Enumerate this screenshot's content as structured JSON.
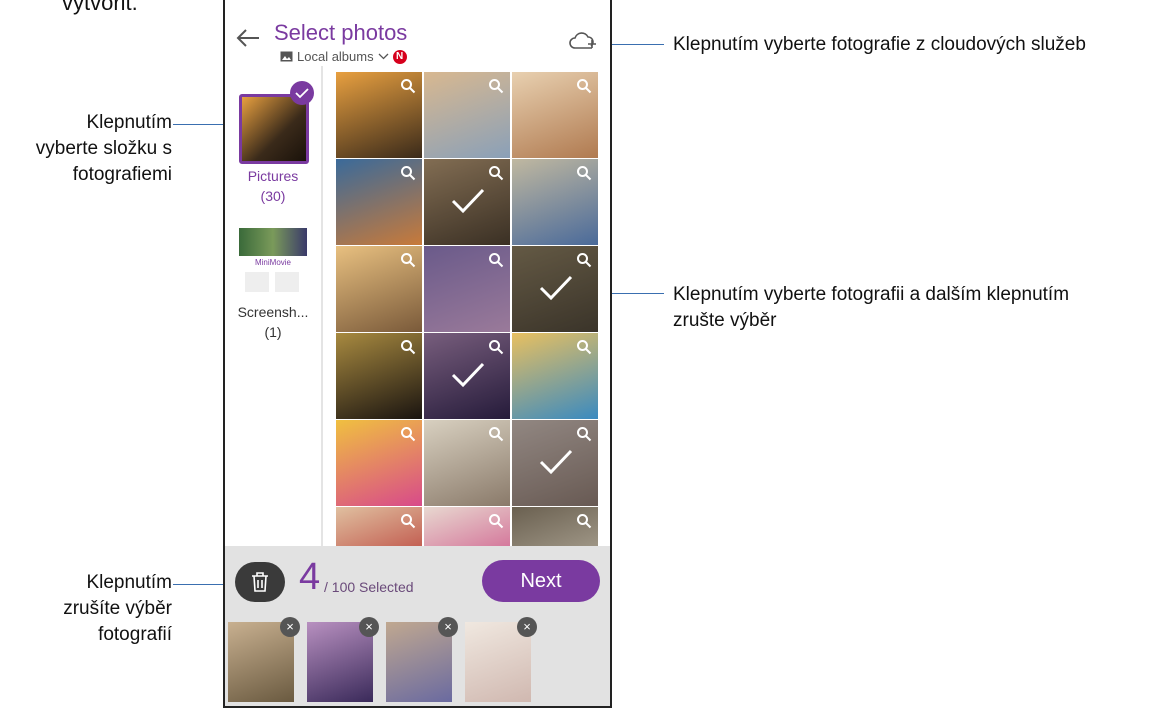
{
  "page_top_fragment": "vytvořit.",
  "callouts": {
    "cloud": "Klepnutím vyberte fotografie z cloudových služeb",
    "folder_line1": "Klepnutím",
    "folder_line2": "vyberte složku s",
    "folder_line3": "fotografiemi",
    "photo_line1": "Klepnutím vyberte fotografii a dalším klepnutím",
    "photo_line2": "zrušte výběr",
    "deselect_line1": "Klepnutím",
    "deselect_line2": "zrušíte výběr",
    "deselect_line3": "fotografií"
  },
  "header": {
    "title": "Select photos",
    "source": "Local albums",
    "badge": "N",
    "back_icon": "arrow-left-icon",
    "cloud_icon": "cloud-add-icon"
  },
  "albums": [
    {
      "name": "Pictures",
      "count": "(30)",
      "selected": true
    },
    {
      "name": "Screensh...",
      "count": "(1)",
      "selected": false,
      "thumb_text": "MiniMovie"
    }
  ],
  "photos": [
    {
      "colors": [
        "#3a2a1a",
        "#e8a040"
      ],
      "selected": false
    },
    {
      "colors": [
        "#8aa0b8",
        "#d8b890"
      ],
      "selected": false
    },
    {
      "colors": [
        "#b07a50",
        "#e8d0b0"
      ],
      "selected": false
    },
    {
      "colors": [
        "#c87a3a",
        "#3a6a9a"
      ],
      "selected": false
    },
    {
      "colors": [
        "#5a4a38",
        "#c8a880"
      ],
      "selected": true
    },
    {
      "colors": [
        "#4a6a9a",
        "#c0b8a0"
      ],
      "selected": false
    },
    {
      "colors": [
        "#7a5a3a",
        "#e8c080"
      ],
      "selected": false
    },
    {
      "colors": [
        "#9a7a9a",
        "#6a5a8a"
      ],
      "selected": false
    },
    {
      "colors": [
        "#5a5040",
        "#9a8a6a"
      ],
      "selected": true
    },
    {
      "colors": [
        "#1a1410",
        "#a88a40"
      ],
      "selected": false
    },
    {
      "colors": [
        "#3a2a5a",
        "#b890c0"
      ],
      "selected": true
    },
    {
      "colors": [
        "#3a8ac0",
        "#e8c060"
      ],
      "selected": false
    },
    {
      "colors": [
        "#d84a8a",
        "#f0c040"
      ],
      "selected": false
    },
    {
      "colors": [
        "#8a7a6a",
        "#d8d0c0"
      ],
      "selected": false
    },
    {
      "colors": [
        "#a08a80",
        "#e0d0c8"
      ],
      "selected": true
    },
    {
      "colors": [
        "#b02020",
        "#e0c0a0"
      ],
      "selected": false
    },
    {
      "colors": [
        "#c83a7a",
        "#e8d8d0"
      ],
      "selected": false
    },
    {
      "colors": [
        "#c0b8a8",
        "#6a6050"
      ],
      "selected": false
    }
  ],
  "selection": {
    "count": "4",
    "total_label": "/ 100 Selected",
    "next_label": "Next",
    "trash_icon": "trash-icon",
    "remove_label": "×"
  },
  "selected_strip": [
    {
      "colors": [
        "#6a5a40",
        "#c8b090"
      ]
    },
    {
      "colors": [
        "#3a2a5a",
        "#b890c0"
      ]
    },
    {
      "colors": [
        "#6a6aa0",
        "#c0a890"
      ]
    },
    {
      "colors": [
        "#d0b8b0",
        "#f0e8e0"
      ]
    }
  ],
  "colors": {
    "accent": "#7a3aa0",
    "callout_line": "#3a6fb0"
  }
}
